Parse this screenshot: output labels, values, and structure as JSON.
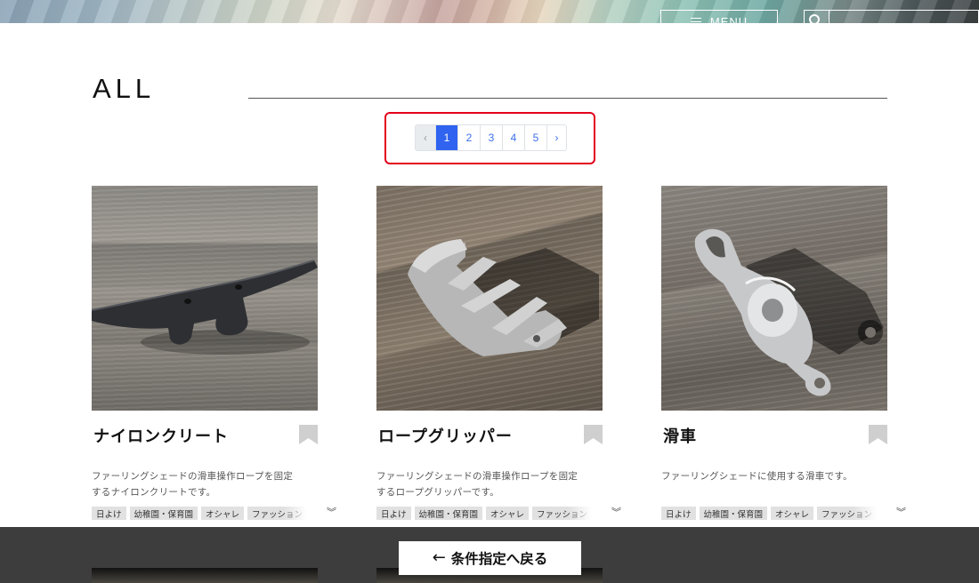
{
  "header": {
    "menu_label": "MENU",
    "menu_icon": "hamburger-icon",
    "search_icon": "search-icon"
  },
  "section": {
    "title": "ALL"
  },
  "pagination": {
    "prev_label": "‹",
    "pages": [
      "1",
      "2",
      "3",
      "4",
      "5"
    ],
    "active_page": "1",
    "next_label": "›"
  },
  "products": [
    {
      "title": "ナイロンクリート",
      "description_line1": "ファーリングシェードの滑車操作ロープを固定",
      "description_line2": "するナイロンクリートです。",
      "tags": [
        "日よけ",
        "幼稚園・保育園",
        "オシャレ",
        "ファッション"
      ]
    },
    {
      "title": "ロープグリッパー",
      "description_line1": "ファーリングシェードの滑車操作ロープを固定",
      "description_line2": "するロープグリッパーです。",
      "tags": [
        "日よけ",
        "幼稚園・保育園",
        "オシャレ",
        "ファッション"
      ]
    },
    {
      "title": "滑車",
      "description_line1": "ファーリングシェードに使用する滑車です。",
      "description_line2": "",
      "tags": [
        "日よけ",
        "幼稚園・保育園",
        "オシャレ",
        "ファッション"
      ]
    }
  ],
  "footer": {
    "back_arrow": "←",
    "back_label": "条件指定へ戻る"
  },
  "colors": {
    "accent": "#2f63f0",
    "highlight_border": "#e3001b",
    "bottom_bar": "#3d3d3d"
  }
}
